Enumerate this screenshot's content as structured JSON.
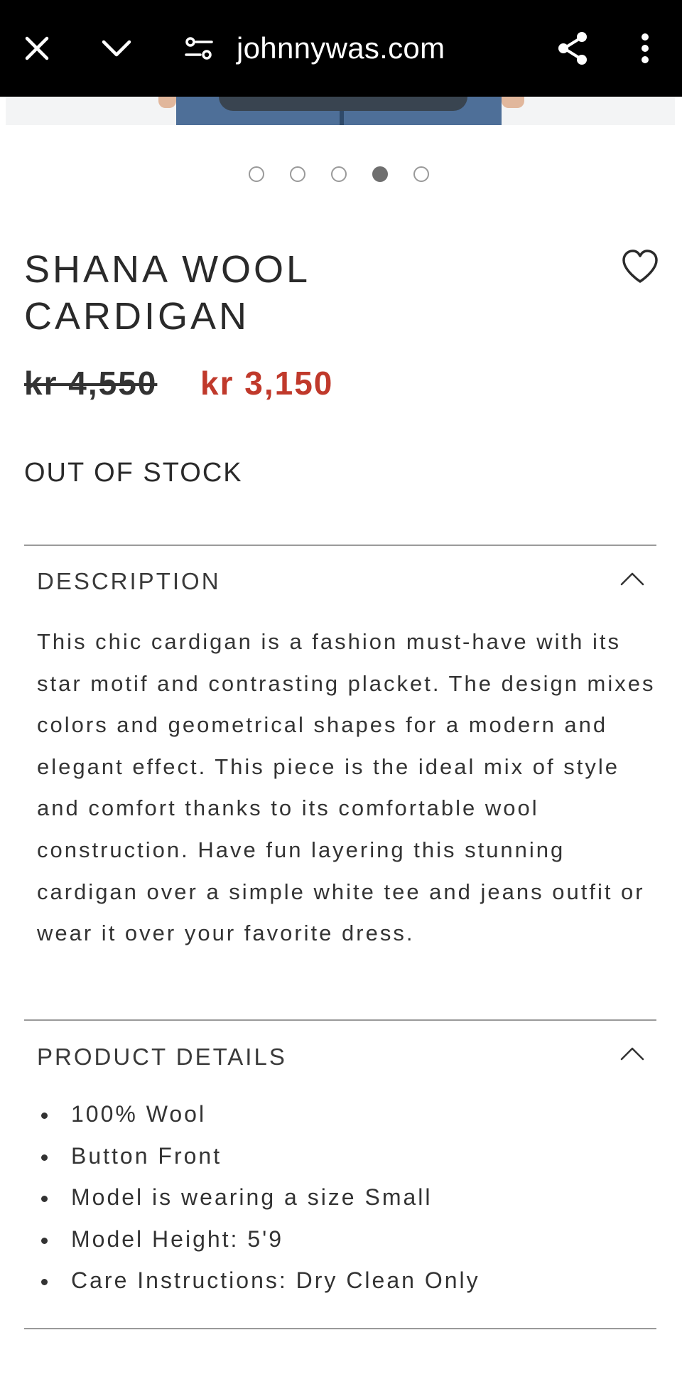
{
  "browser": {
    "url": "johnnywas.com",
    "icons": [
      "close-icon",
      "chevron-down-icon",
      "tune-icon",
      "share-icon",
      "more-vert-icon"
    ]
  },
  "carousel": {
    "total": 5,
    "active_index": 3
  },
  "product": {
    "title": "SHANA WOOL CARDIGAN",
    "price_original": "kr 4,550",
    "price_sale": "kr 3,150",
    "stock_status": "OUT OF STOCK"
  },
  "description": {
    "heading": "DESCRIPTION",
    "text": "This chic cardigan is a fashion must-have with its star motif and contrasting placket. The design mixes colors and geometrical shapes for a modern and elegant effect. This piece is the ideal mix of style and comfort thanks to its comfortable wool construction. Have fun layering this stunning cardigan over a simple white tee and jeans outfit or wear it over your favorite dress."
  },
  "product_details": {
    "heading": "PRODUCT DETAILS",
    "items": [
      "100% Wool",
      "Button Front",
      "Model is wearing a size Small",
      "Model Height: 5'9",
      "Care Instructions: Dry Clean Only"
    ]
  },
  "colors": {
    "sale_price": "#c0392b",
    "topbar_bg": "#000000"
  }
}
